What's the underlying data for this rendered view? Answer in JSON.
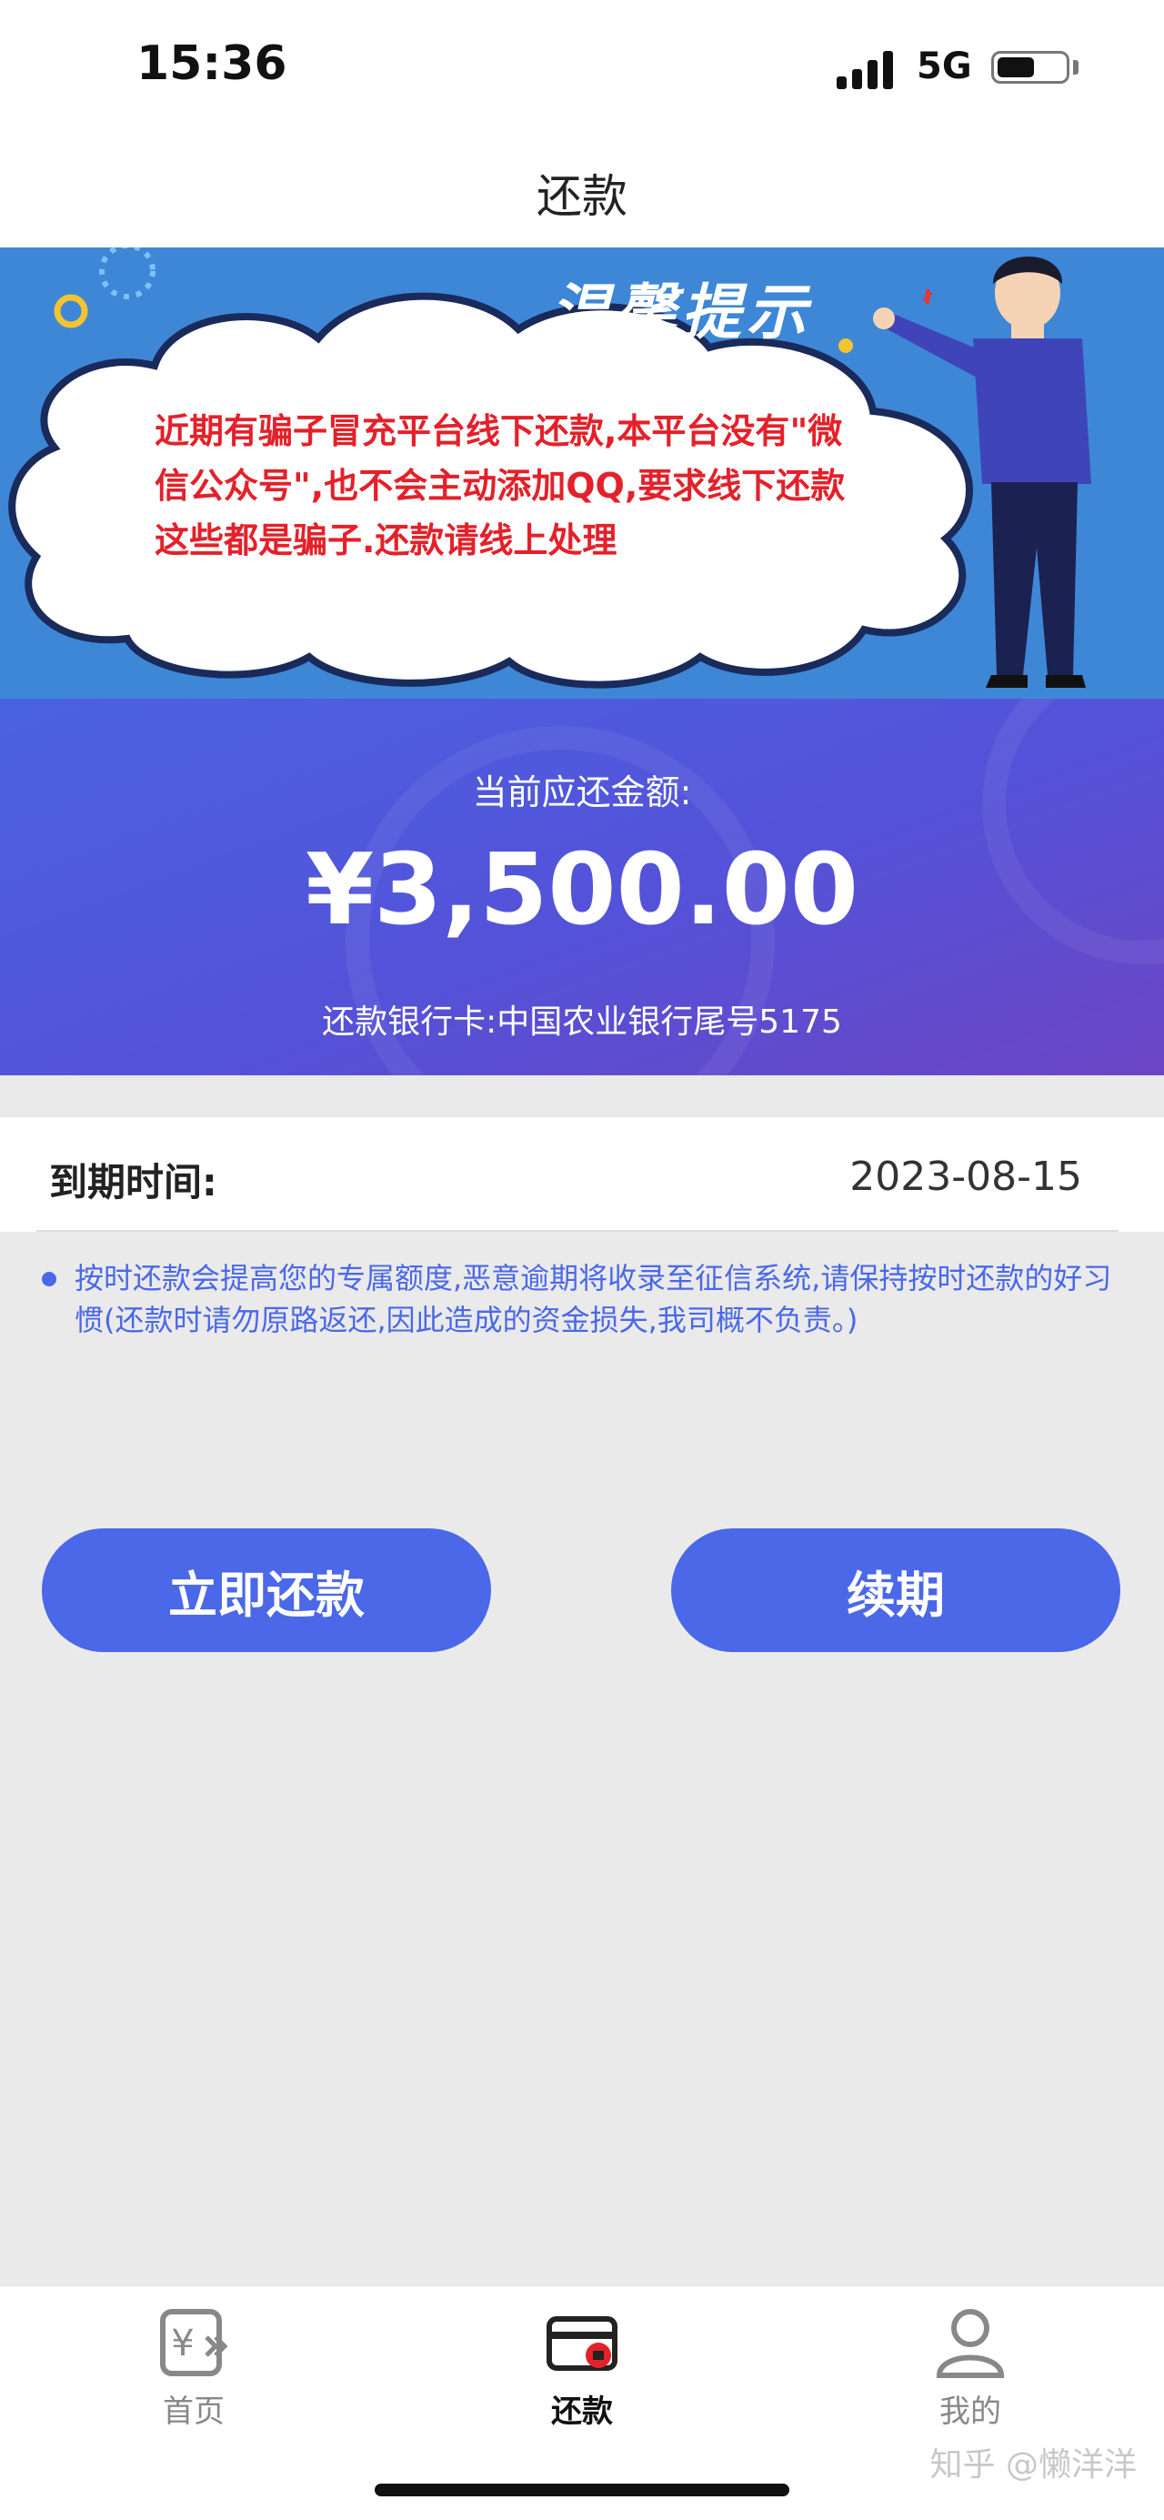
{
  "status_bar": {
    "time": "15:36",
    "network": "5G"
  },
  "header": {
    "title": "还款"
  },
  "banner": {
    "title": "温馨提示",
    "notice": "近期有骗子冒充平台线下还款,本平台没有\"微信公众号\",也不会主动添加QQ,要求线下还款这些都是骗子.还款请线上处理"
  },
  "amount": {
    "label": "当前应还金额:",
    "value": "¥3,500.00",
    "bank_card": "还款银行卡:中国农业银行尾号5175"
  },
  "due": {
    "label": "到期时间:",
    "value": "2023-08-15"
  },
  "tip": "按时还款会提高您的专属额度,恶意逾期将收录至征信系统,请保持按时还款的好习惯(还款时请勿原路返还,因此造成的资金损失,我司概不负责。)",
  "buttons": {
    "repay": "立即还款",
    "renew": "续期"
  },
  "tabs": {
    "home": {
      "label": "首页",
      "icon": "yen-icon"
    },
    "repay": {
      "label": "还款",
      "icon": "card-icon"
    },
    "mine": {
      "label": "我的",
      "icon": "user-icon"
    }
  },
  "watermark": "知乎 @懒洋洋",
  "colors": {
    "accent": "#4a68e8",
    "banner_bg": "#3d87d6",
    "notice_red": "#e3212a"
  }
}
